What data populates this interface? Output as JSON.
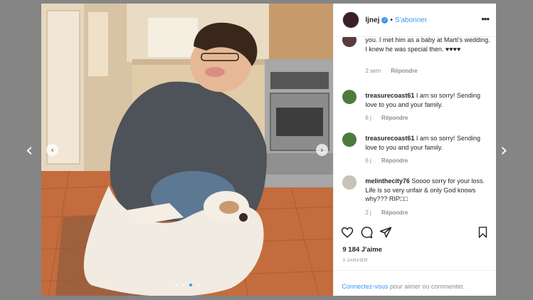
{
  "viewer": {
    "prev_arrow": "‹",
    "next_arrow": "›"
  },
  "post": {
    "username": "ljnej",
    "separator": "•",
    "follow_label": "S'abonner",
    "more_label": "•••",
    "photo_prev": "‹",
    "photo_next": "›",
    "carousel": {
      "count": 4,
      "active": 3
    }
  },
  "comments": [
    {
      "username": "",
      "text": "you. I met him as a baby at Marti's wedding. I knew he was special then. ♥♥♥♥",
      "age": "2 sem",
      "reply_label": "Répondre"
    },
    {
      "username": "treasurecoast61",
      "text": "I am so sorry! Sending love to you and your family.",
      "age": "6 j",
      "reply_label": "Répondre"
    },
    {
      "username": "treasurecoast61",
      "text": "I am so sorry! Sending love to you and your family.",
      "age": "6 j",
      "reply_label": "Répondre"
    },
    {
      "username": "melinthecity76",
      "text": "Soooo sorry for your loss. Life is so very unfair & only God knows why??? RIP□□",
      "age": "2 j",
      "reply_label": "Répondre"
    }
  ],
  "engagement": {
    "likes": "9 184 J'aime",
    "date": "3 JANVIER"
  },
  "footer": {
    "login_link": "Connectez-vous",
    "login_suffix": " pour aimer ou commenter."
  },
  "icons": {
    "like": "heart-outline-icon",
    "comment": "speech-bubble-icon",
    "share": "paper-plane-icon",
    "save": "bookmark-icon",
    "verified": "verified-badge-icon"
  },
  "colors": {
    "link": "#3897f0",
    "text": "#262626",
    "muted": "#8e8e8e"
  }
}
